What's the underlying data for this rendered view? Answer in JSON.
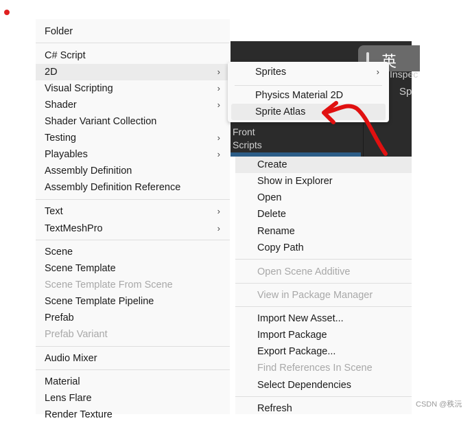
{
  "left_menu": {
    "items": [
      {
        "label": "Folder"
      },
      {
        "label": "C# Script"
      },
      {
        "label": "2D",
        "submenu": true,
        "highlighted": true
      },
      {
        "label": "Visual Scripting",
        "submenu": true
      },
      {
        "label": "Shader",
        "submenu": true
      },
      {
        "label": "Shader Variant Collection"
      },
      {
        "label": "Testing",
        "submenu": true
      },
      {
        "label": "Playables",
        "submenu": true
      },
      {
        "label": "Assembly Definition"
      },
      {
        "label": "Assembly Definition Reference"
      },
      {
        "label": "Text",
        "submenu": true
      },
      {
        "label": "TextMeshPro",
        "submenu": true
      },
      {
        "label": "Scene"
      },
      {
        "label": "Scene Template"
      },
      {
        "label": "Scene Template From Scene",
        "disabled": true
      },
      {
        "label": "Scene Template Pipeline"
      },
      {
        "label": "Prefab"
      },
      {
        "label": "Prefab Variant",
        "disabled": true
      },
      {
        "label": "Audio Mixer"
      },
      {
        "label": "Material"
      },
      {
        "label": "Lens Flare"
      },
      {
        "label": "Render Texture"
      }
    ]
  },
  "submenu_2d": {
    "items": [
      {
        "label": "Sprites",
        "submenu": true
      },
      {
        "label": "Physics Material 2D"
      },
      {
        "label": "Sprite Atlas",
        "highlighted": true
      }
    ]
  },
  "right_menu": {
    "items": [
      {
        "label": "Create",
        "highlighted": true
      },
      {
        "label": "Show in Explorer"
      },
      {
        "label": "Open"
      },
      {
        "label": "Delete"
      },
      {
        "label": "Rename"
      },
      {
        "label": "Copy Path"
      },
      {
        "label": "Open Scene Additive",
        "disabled": true
      },
      {
        "label": "View in Package Manager",
        "disabled": true
      },
      {
        "label": "Import New Asset..."
      },
      {
        "label": "Import Package"
      },
      {
        "label": "Export Package..."
      },
      {
        "label": "Find References In Scene",
        "disabled": true
      },
      {
        "label": "Select Dependencies"
      },
      {
        "label": "Refresh"
      }
    ]
  },
  "background_panel": {
    "items": [
      "Front",
      "Scripts"
    ],
    "inspector_partial": "Inspec",
    "sp_partial": "Sp"
  },
  "ime_indicator": {
    "label": "英"
  },
  "watermark": "CSDN @秩沅",
  "arrow_annotation_color": "#e01010"
}
